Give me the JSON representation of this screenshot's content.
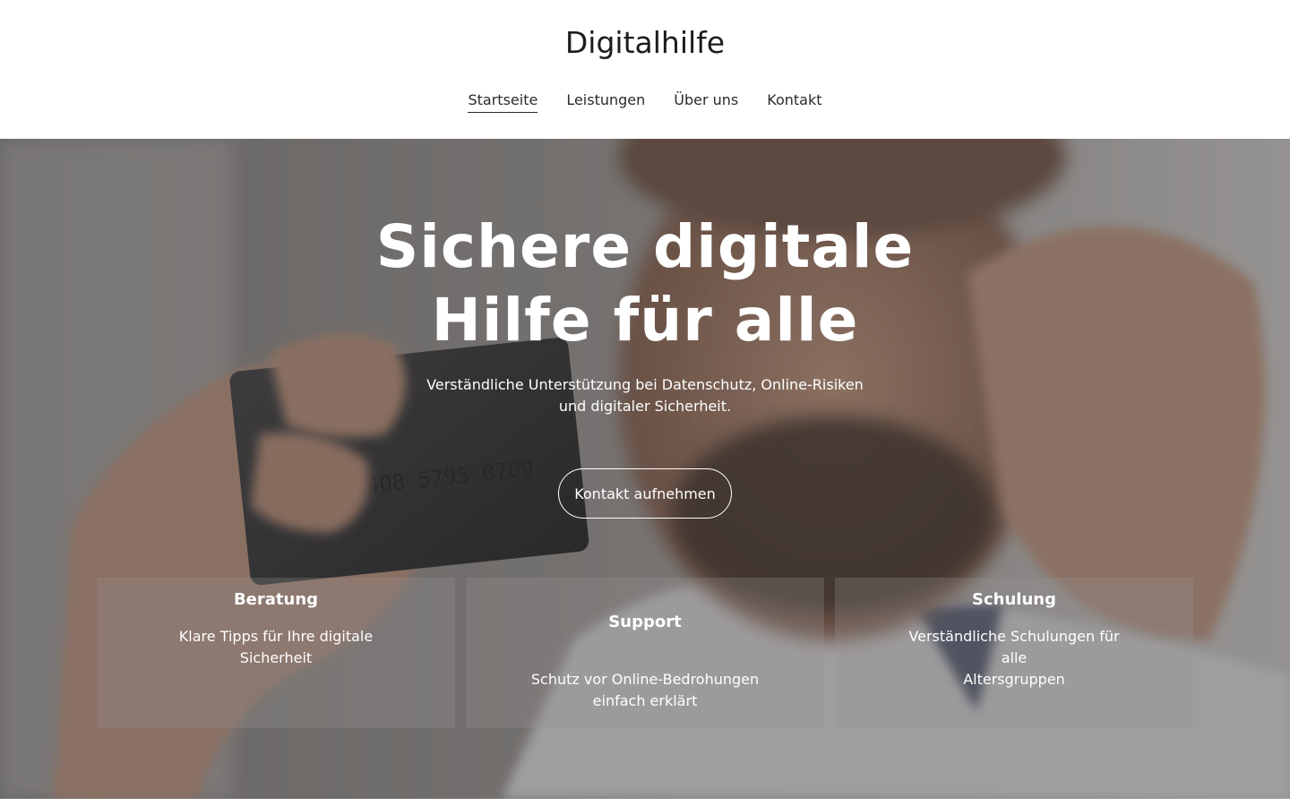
{
  "header": {
    "site_title": "Digitalhilfe",
    "nav": [
      {
        "label": "Startseite",
        "active": true
      },
      {
        "label": "Leistungen",
        "active": false
      },
      {
        "label": "Über uns",
        "active": false
      },
      {
        "label": "Kontakt",
        "active": false
      }
    ]
  },
  "hero": {
    "title_line1": "Sichere digitale",
    "title_line2": "Hilfe für alle",
    "subtitle_line1": "Verständliche Unterstützung bei Datenschutz, Online-Risiken",
    "subtitle_line2": "und digitaler Sicherheit.",
    "cta_label": "Kontakt aufnehmen",
    "card_number_text": "2408 5795 0709"
  },
  "features": [
    {
      "title": "Beratung",
      "text_line1": "Klare Tipps für Ihre digitale",
      "text_line2": "Sicherheit"
    },
    {
      "title": "Support",
      "text_line1": "Schutz vor Online-Bedrohungen",
      "text_line2": "einfach erklärt"
    },
    {
      "title": "Schulung",
      "text_line1": "Verständliche Schulungen für alle",
      "text_line2": "Altersgruppen"
    }
  ],
  "colors": {
    "text_dark": "#1c1c1c",
    "hero_text": "#ffffff",
    "card_background": "rgba(150,148,148,0.28)"
  }
}
